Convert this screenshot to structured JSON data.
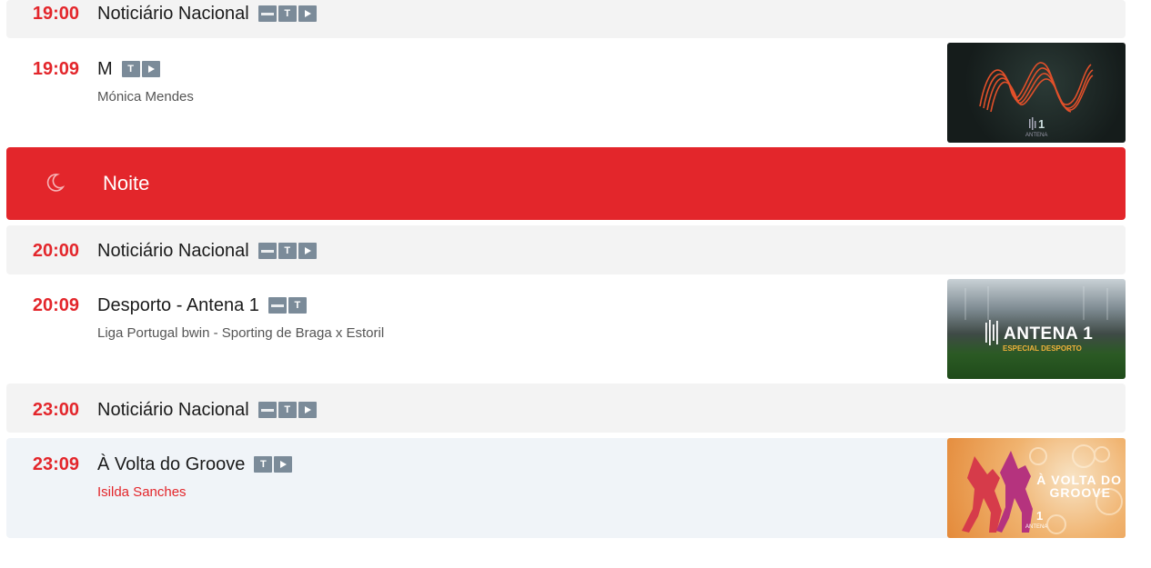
{
  "rows": [
    {
      "time": "19:00",
      "title": "Noticiário Nacional",
      "badges": [
        "rtp",
        "T",
        "play"
      ]
    },
    {
      "time": "19:09",
      "title": "M",
      "subtitle": "Mónica Mendes",
      "badges": [
        "T",
        "play"
      ],
      "thumb_text": "1",
      "thumb_small": "ANTENA"
    },
    {
      "time": "20:00",
      "title": "Noticiário Nacional",
      "badges": [
        "rtp",
        "T",
        "play"
      ]
    },
    {
      "time": "20:09",
      "title": "Desporto - Antena 1",
      "subtitle": "Liga Portugal bwin - Sporting de Braga x Estoril",
      "badges": [
        "rtp",
        "T"
      ],
      "thumb_text": "ANTENA 1",
      "thumb_small": "ESPECIAL DESPORTO"
    },
    {
      "time": "23:00",
      "title": "Noticiário Nacional",
      "badges": [
        "rtp",
        "T",
        "play"
      ]
    },
    {
      "time": "23:09",
      "title": "À Volta do Groove",
      "subtitle": "Isilda Sanches",
      "badges": [
        "T",
        "play"
      ],
      "thumb_text": "À VOLTA DO GROOVE",
      "thumb_line1": "À VOLTA DO",
      "thumb_line2": "GROOVE",
      "thumb_logo": "1",
      "thumb_small": "ANTENA"
    }
  ],
  "section": {
    "label": "Noite",
    "icon": "moon-icon"
  },
  "badge_T": "T",
  "colors": {
    "accent": "#e3262b",
    "badge": "#7b8b99",
    "row_grey": "#f3f3f3",
    "row_blue": "#f0f4f8"
  }
}
